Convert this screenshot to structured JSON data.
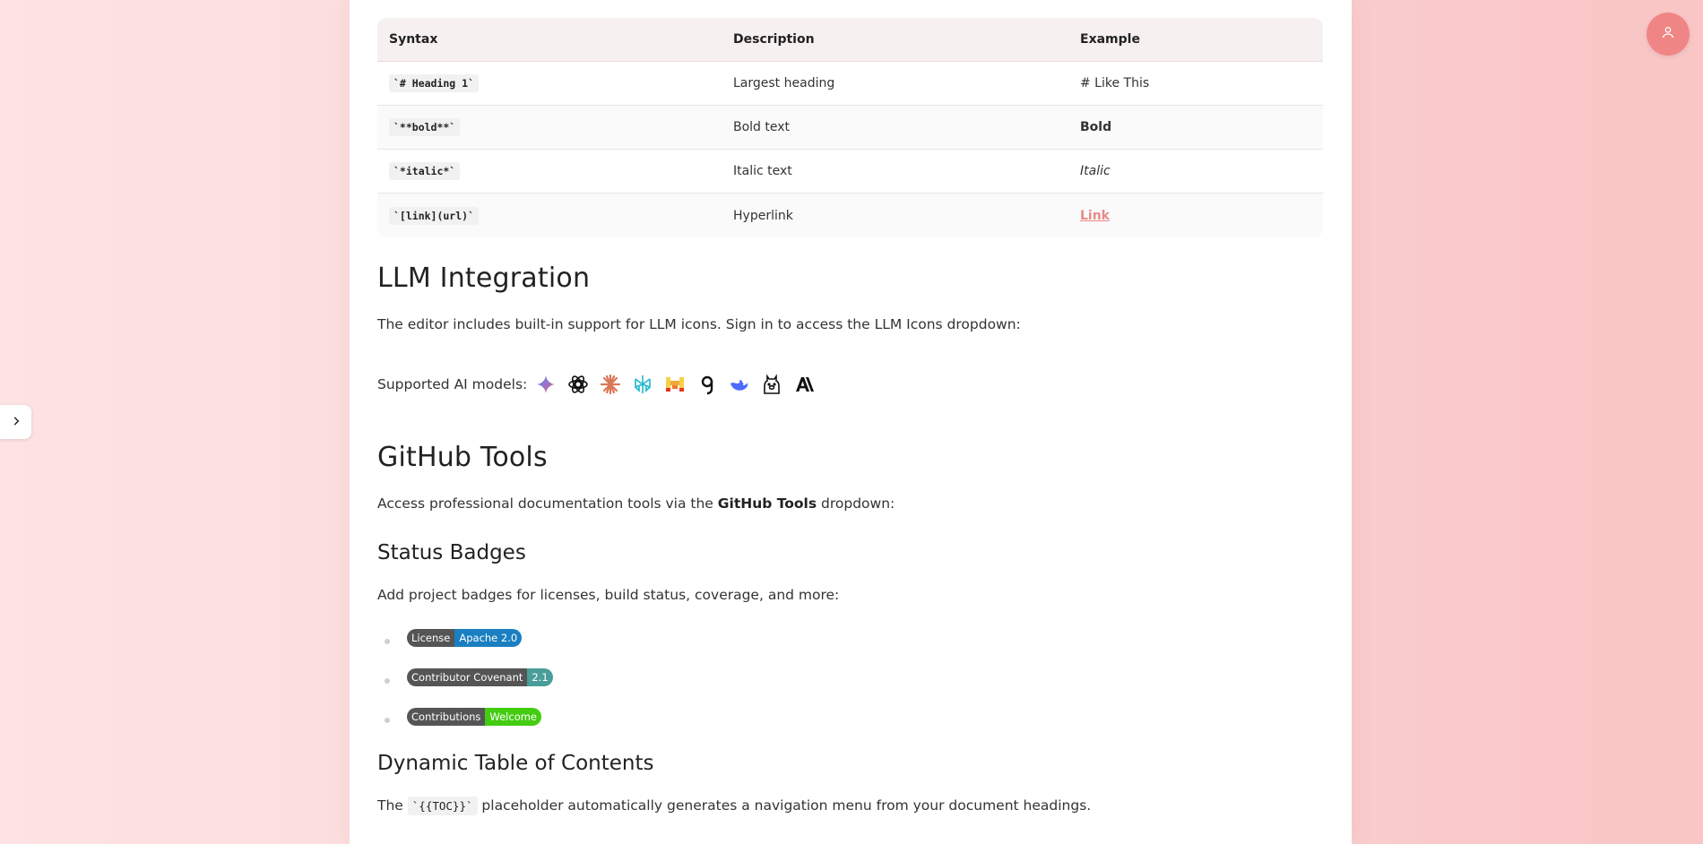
{
  "table": {
    "headers": [
      "Syntax",
      "Description",
      "Example"
    ],
    "rows": [
      {
        "syntax": "`# Heading 1`",
        "description": "Largest heading",
        "example": "# Like This"
      },
      {
        "syntax": "`**bold**`",
        "description": "Bold text",
        "example": "Bold"
      },
      {
        "syntax": "`*italic*`",
        "description": "Italic text",
        "example": "Italic"
      },
      {
        "syntax": "`[link](url)`",
        "description": "Hyperlink",
        "example": "Link"
      }
    ]
  },
  "llm": {
    "heading": "LLM Integration",
    "text": "The editor includes built-in support for LLM icons. Sign in to access the LLM Icons dropdown:",
    "models_label": "Supported AI models:",
    "icons": [
      "gemini-icon",
      "openai-icon",
      "claude-icon",
      "perplexity-icon",
      "mistral-icon",
      "grok-icon",
      "deepseek-icon",
      "ollama-icon",
      "anthropic-icon"
    ]
  },
  "github": {
    "heading": "GitHub Tools",
    "text_before": "Access professional documentation tools via the ",
    "text_bold": "GitHub Tools",
    "text_after": " dropdown:"
  },
  "badges_section": {
    "heading": "Status Badges",
    "text": "Add project badges for licenses, build status, coverage, and more:",
    "badges": [
      {
        "label": "License",
        "value": "Apache 2.0",
        "color": "#1a7fc1"
      },
      {
        "label": "Contributor Covenant",
        "value": "2.1",
        "color": "#4a9e99"
      },
      {
        "label": "Contributions",
        "value": "Welcome",
        "color": "#44cc11"
      }
    ]
  },
  "toc": {
    "heading": "Dynamic Table of Contents",
    "text_before": "The ",
    "code": "`{{TOC}}`",
    "text_after": " placeholder automatically generates a navigation menu from your document headings."
  },
  "colors": {
    "accent": "#f08585",
    "link": "#e88a8a"
  },
  "controls": {
    "avatar_icon": "user-icon",
    "sidebar_icon": "chevron-right-icon"
  }
}
